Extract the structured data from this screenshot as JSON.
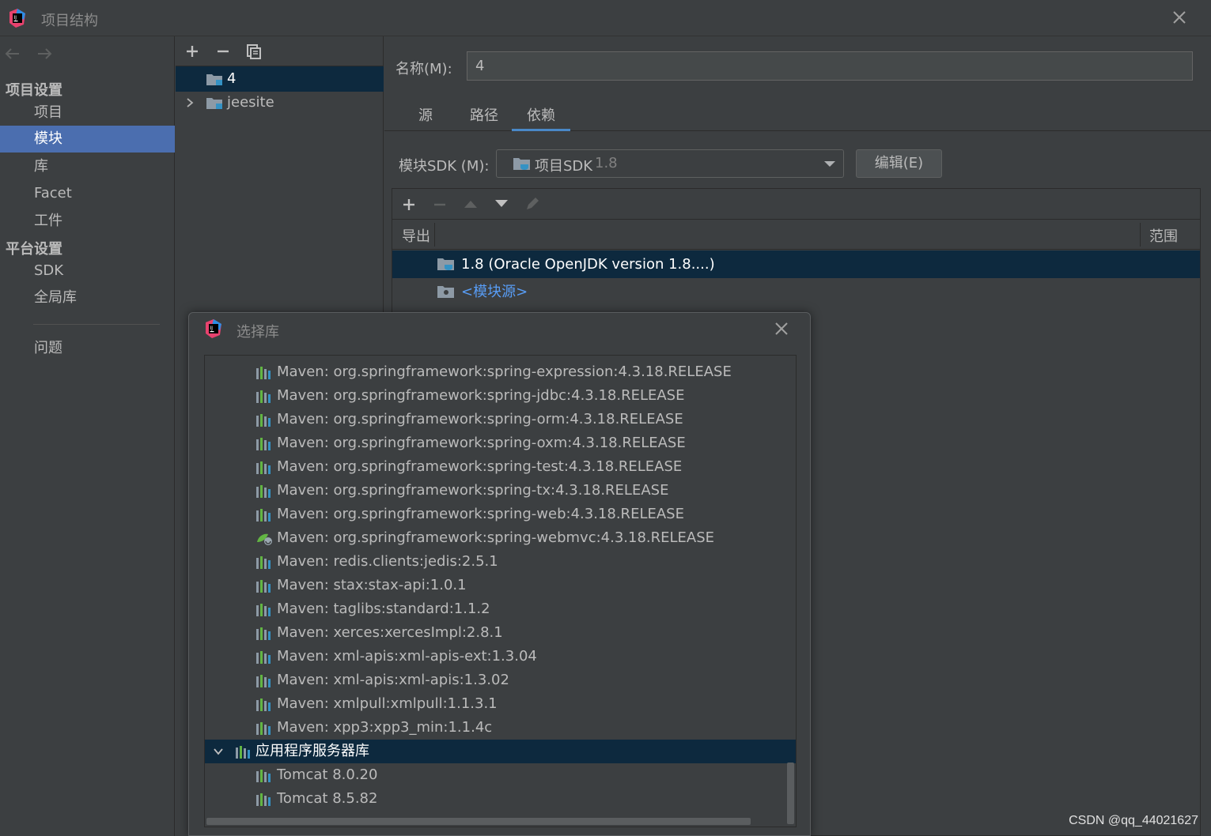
{
  "window": {
    "title": "项目结构"
  },
  "nav": {
    "project_settings": "项目设置",
    "items_project": [
      "项目",
      "模块",
      "库",
      "Facet",
      "工件"
    ],
    "platform_settings": "平台设置",
    "items_platform": [
      "SDK",
      "全局库"
    ],
    "problems": "问题",
    "selected": "模块"
  },
  "modules": {
    "items": [
      {
        "name": "4",
        "selected": true
      },
      {
        "name": "jeesite",
        "selected": false
      }
    ]
  },
  "detail": {
    "name_label": "名称(M):",
    "name_value": "4",
    "tabs": [
      "源",
      "路径",
      "依赖"
    ],
    "active_tab": "依赖",
    "sdk_label": "模块SDK (M):",
    "sdk_value": "项目SDK",
    "sdk_version": "1.8",
    "edit_button": "编辑(E)",
    "columns": {
      "export": "导出",
      "scope": "范围"
    },
    "dependencies": [
      {
        "label": "1.8 (Oracle OpenJDK version 1.8....)",
        "selected": true,
        "link": false
      },
      {
        "label": "<模块源>",
        "selected": false,
        "link": true
      }
    ]
  },
  "dialog": {
    "title": "选择库",
    "libraries": [
      "Maven: org.springframework:spring-expression:4.3.18.RELEASE",
      "Maven: org.springframework:spring-jdbc:4.3.18.RELEASE",
      "Maven: org.springframework:spring-orm:4.3.18.RELEASE",
      "Maven: org.springframework:spring-oxm:4.3.18.RELEASE",
      "Maven: org.springframework:spring-test:4.3.18.RELEASE",
      "Maven: org.springframework:spring-tx:4.3.18.RELEASE",
      "Maven: org.springframework:spring-web:4.3.18.RELEASE",
      "Maven: org.springframework:spring-webmvc:4.3.18.RELEASE",
      "Maven: redis.clients:jedis:2.5.1",
      "Maven: stax:stax-api:1.0.1",
      "Maven: taglibs:standard:1.1.2",
      "Maven: xerces:xercesImpl:2.8.1",
      "Maven: xml-apis:xml-apis-ext:1.3.04",
      "Maven: xml-apis:xml-apis:1.3.02",
      "Maven: xmlpull:xmlpull:1.1.3.1",
      "Maven: xpp3:xpp3_min:1.1.4c"
    ],
    "group_label": "应用程序服务器库",
    "group_items": [
      "Tomcat 8.0.20",
      "Tomcat 8.5.82"
    ]
  },
  "watermark": "CSDN @qq_44021627",
  "colors": {
    "selection": "#0d293e",
    "nav_selected": "#4b6eaf",
    "link": "#589df6",
    "background": "#3c3f41"
  }
}
